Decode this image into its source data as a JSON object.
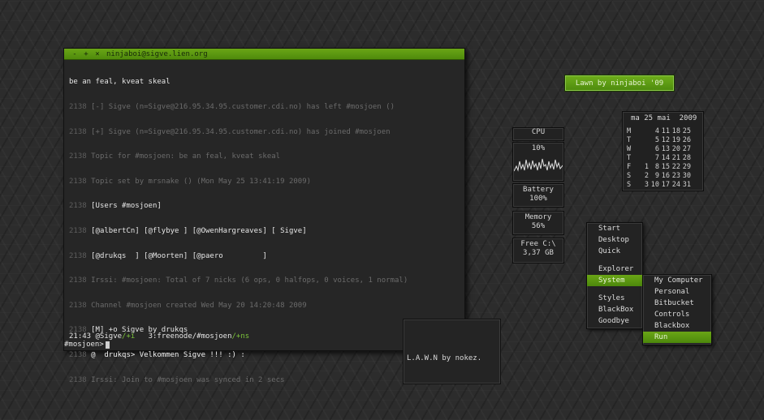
{
  "terminal": {
    "title": "ninjaboi@sigve.lien.org",
    "buttons": [
      "-",
      "+",
      "×"
    ],
    "lines": [
      {
        "ts": "",
        "text": "be an feal, kveat skeal",
        "style": "bright"
      },
      {
        "ts": "2138",
        "text": "[-] Sigve (n=Sigve@216.95.34.95.customer.cdi.no) has left #mosjoen ()",
        "style": "dim"
      },
      {
        "ts": "2138",
        "text": "[+] Sigve (n=Sigve@216.95.34.95.customer.cdi.no) has joined #mosjoen",
        "style": "dim"
      },
      {
        "ts": "2138",
        "text": "Topic for #mosjoen: be an feal, kveat skeal",
        "style": "dim"
      },
      {
        "ts": "2138",
        "text": "Topic set by mrsnake () (Mon May 25 13:41:19 2009)",
        "style": "dim"
      },
      {
        "ts": "2138",
        "text": "[Users #mosjoen]",
        "style": "bright"
      },
      {
        "ts": "2138",
        "text": "[@albertCn] [@flybye ] [@OwenHargreaves] [ Sigve]",
        "style": "bright"
      },
      {
        "ts": "2138",
        "text": "[@drukqs  ] [@Moorten] [@paero         ]",
        "style": "bright"
      },
      {
        "ts": "2138",
        "text": "Irssi: #mosjoen: Total of 7 nicks (6 ops, 0 halfops, 0 voices, 1 normal)",
        "style": "dim"
      },
      {
        "ts": "2138",
        "text": "Channel #mosjoen created Wed May 20 14:20:48 2009",
        "style": "dim"
      },
      {
        "ts": "2138",
        "text": "[M] +o Sigve by drukqs",
        "style": "bright"
      },
      {
        "ts": "2138",
        "text": "@  drukqs> Velkommen Sigve !!! :) :",
        "style": "white"
      },
      {
        "ts": "2138",
        "text": "Irssi: Join to #mosjoen was synced in 2 secs",
        "style": "dim"
      }
    ],
    "status": {
      "time": "21:43",
      "nick": "@Sigve",
      "nick_mode": "/+i",
      "window": "3:freenode/#mosjoen",
      "window_mode": "/+ns"
    },
    "prompt": "#mosjoen>"
  },
  "lawn_box": {
    "text": "L.A.W.N by nokez."
  },
  "lawn_button": {
    "label": "Lawn by ninjaboi '09"
  },
  "calendar": {
    "header": "ma 25 mai  2009",
    "rows": [
      {
        "day": "M",
        "dates": [
          "",
          "4",
          "11",
          "18",
          "25"
        ]
      },
      {
        "day": "T",
        "dates": [
          "",
          "5",
          "12",
          "19",
          "26"
        ]
      },
      {
        "day": "W",
        "dates": [
          "",
          "6",
          "13",
          "20",
          "27"
        ]
      },
      {
        "day": "T",
        "dates": [
          "",
          "7",
          "14",
          "21",
          "28"
        ]
      },
      {
        "day": "F",
        "dates": [
          "1",
          "8",
          "15",
          "22",
          "29"
        ]
      },
      {
        "day": "S",
        "dates": [
          "2",
          "9",
          "16",
          "23",
          "30"
        ]
      },
      {
        "day": "S",
        "dates": [
          "3",
          "10",
          "17",
          "24",
          "31"
        ]
      }
    ]
  },
  "monitors": {
    "cpu_label": "CPU",
    "cpu_value": "10%",
    "battery_label": "Battery",
    "battery_value": "100%",
    "memory_label": "Memory",
    "memory_value": "56%",
    "disk_label": "Free C:\\",
    "disk_value": "3,37 GB"
  },
  "menu": {
    "main_items": [
      "Start",
      "Desktop",
      "Quick",
      "",
      "Explorer",
      "System",
      "",
      "Styles",
      "BlackBox",
      "Goodbye"
    ],
    "selected": "System",
    "submenu_items": [
      "My Computer",
      "Personal",
      "Bitbucket",
      "Controls",
      "Blackbox",
      "Run"
    ],
    "submenu_selected": "Run"
  },
  "colors": {
    "accent": "#5c9a12",
    "background": "#2c2c2c"
  }
}
